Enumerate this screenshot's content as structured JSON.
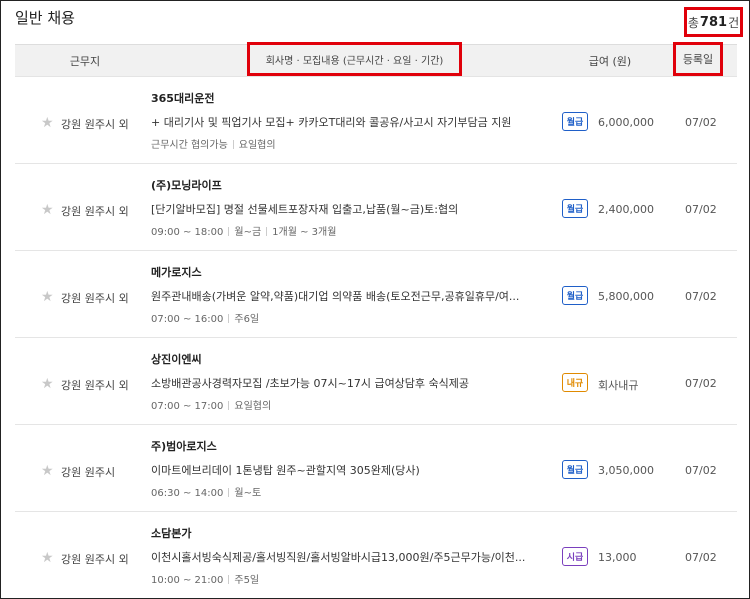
{
  "section_title": "일반 채용",
  "total": {
    "prefix": "총",
    "count": "781",
    "suffix": "건"
  },
  "header": {
    "location": "근무지",
    "title": "회사명 · 모집내용 (근무시간 · 요일 · 기간)",
    "pay": "급여 (원)",
    "date": "등록일"
  },
  "colors": {
    "highlight_box": "#e0000a",
    "monthly": "#1f5fc8",
    "negotiable": "#e08a00",
    "hourly": "#7a3fbd"
  },
  "rows": [
    {
      "location": "강원 원주시 외",
      "company": "365대리운전",
      "desc": "+ 대리기사 및 픽업기사 모집+ 카카오T대리와 콜공유/사고시 자기부담금 지원",
      "meta": [
        "근무시간 협의가능",
        "요일협의"
      ],
      "pay_type": "월급",
      "pay_color": "#1f5fc8",
      "pay": "6,000,000",
      "date": "07/02"
    },
    {
      "location": "강원 원주시 외",
      "company": "(주)모닝라이프",
      "desc": "[단기알바모집] 명절 선물세트포장자재 입출고,납품(월~금)토:협의",
      "meta": [
        "09:00 ~ 18:00",
        "월~금",
        "1개월 ~ 3개월"
      ],
      "pay_type": "월급",
      "pay_color": "#1f5fc8",
      "pay": "2,400,000",
      "date": "07/02"
    },
    {
      "location": "강원 원주시 외",
      "company": "메가로지스",
      "desc": "원주관내배송(가벼운 알약,약품)대기업 의약품 배송(토오전근무,공휴일휴무/여...",
      "meta": [
        "07:00 ~ 16:00",
        "주6일"
      ],
      "pay_type": "월급",
      "pay_color": "#1f5fc8",
      "pay": "5,800,000",
      "date": "07/02"
    },
    {
      "location": "강원 원주시 외",
      "company": "상진이엔씨",
      "desc": "소방배관공사경력자모집 /초보가능 07시~17시 급여상담후 숙식제공",
      "meta": [
        "07:00 ~ 17:00",
        "요일협의"
      ],
      "pay_type": "내규",
      "pay_color": "#e08a00",
      "pay": "회사내규",
      "date": "07/02"
    },
    {
      "location": "강원 원주시",
      "company": "주)범아로지스",
      "desc": "이마트에브리데이 1톤냉탑 원주~관할지역 305완제(당사)",
      "meta": [
        "06:30 ~ 14:00",
        "월~토"
      ],
      "pay_type": "월급",
      "pay_color": "#1f5fc8",
      "pay": "3,050,000",
      "date": "07/02"
    },
    {
      "location": "강원 원주시 외",
      "company": "소담본가",
      "desc": "이천시홀서빙숙식제공/홀서빙직원/홀서빙알바시급13,000원/주5근무가능/이천...",
      "meta": [
        "10:00 ~ 21:00",
        "주5일"
      ],
      "pay_type": "시급",
      "pay_color": "#7a3fbd",
      "pay": "13,000",
      "date": "07/02"
    }
  ]
}
